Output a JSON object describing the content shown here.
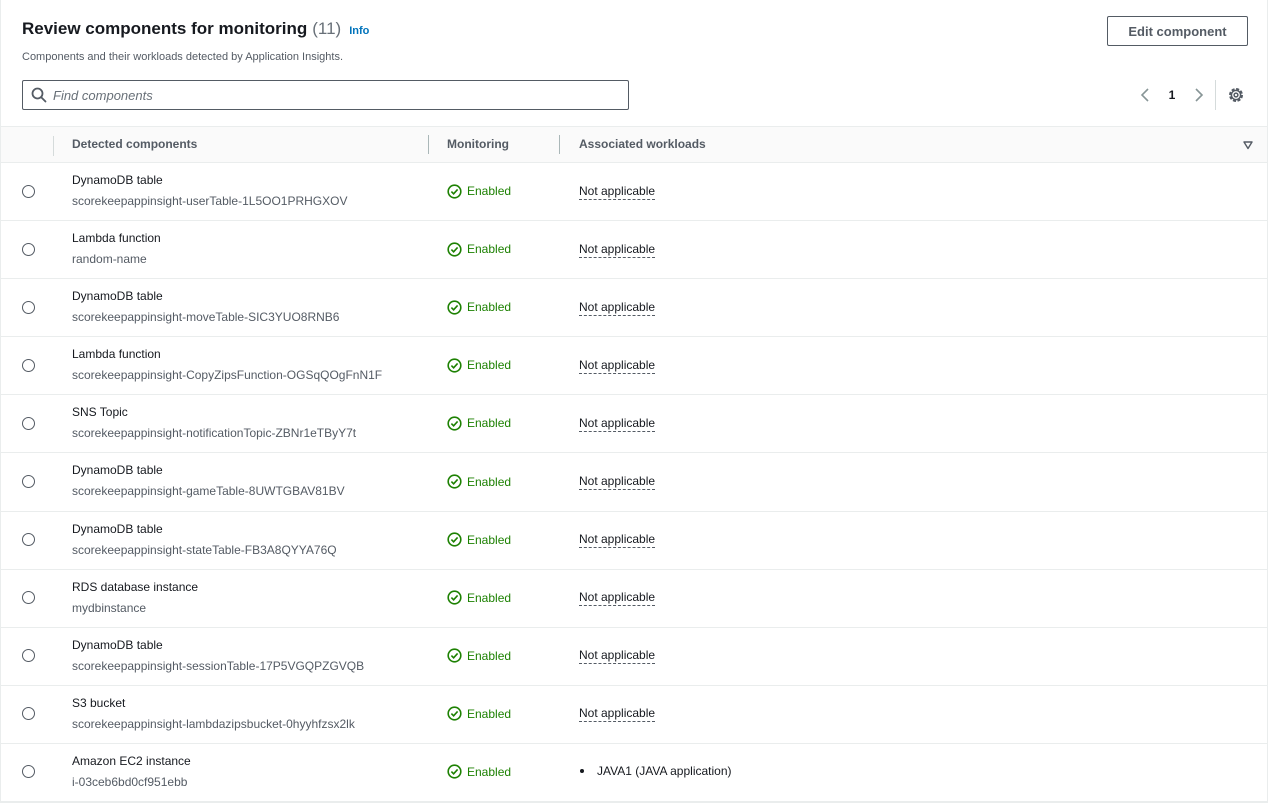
{
  "header": {
    "title": "Review components for monitoring",
    "count": "(11)",
    "info_link": "Info",
    "subtitle": "Components and their workloads detected by Application Insights.",
    "edit_button": "Edit component"
  },
  "search": {
    "placeholder": "Find components",
    "value": ""
  },
  "pagination": {
    "current_page": "1"
  },
  "table": {
    "columns": [
      "Detected components",
      "Monitoring",
      "Associated workloads"
    ],
    "rows": [
      {
        "type": "DynamoDB table",
        "name": "scorekeepappinsight-userTable-1L5OO1PRHGXOV",
        "monitoring": "Enabled",
        "workload": "Not applicable"
      },
      {
        "type": "Lambda function",
        "name": "random-name",
        "monitoring": "Enabled",
        "workload": "Not applicable"
      },
      {
        "type": "DynamoDB table",
        "name": "scorekeepappinsight-moveTable-SIC3YUO8RNB6",
        "monitoring": "Enabled",
        "workload": "Not applicable"
      },
      {
        "type": "Lambda function",
        "name": "scorekeepappinsight-CopyZipsFunction-OGSqQOgFnN1F",
        "monitoring": "Enabled",
        "workload": "Not applicable"
      },
      {
        "type": "SNS Topic",
        "name": "scorekeepappinsight-notificationTopic-ZBNr1eTByY7t",
        "monitoring": "Enabled",
        "workload": "Not applicable"
      },
      {
        "type": "DynamoDB table",
        "name": "scorekeepappinsight-gameTable-8UWTGBAV81BV",
        "monitoring": "Enabled",
        "workload": "Not applicable"
      },
      {
        "type": "DynamoDB table",
        "name": "scorekeepappinsight-stateTable-FB3A8QYYA76Q",
        "monitoring": "Enabled",
        "workload": "Not applicable"
      },
      {
        "type": "RDS database instance",
        "name": "mydbinstance",
        "monitoring": "Enabled",
        "workload": "Not applicable"
      },
      {
        "type": "DynamoDB table",
        "name": "scorekeepappinsight-sessionTable-17P5VGQPZGVQB",
        "monitoring": "Enabled",
        "workload": "Not applicable"
      },
      {
        "type": "S3 bucket",
        "name": "scorekeepappinsight-lambdazipsbucket-0hyyhfzsx2lk",
        "monitoring": "Enabled",
        "workload": "Not applicable"
      },
      {
        "type": "Amazon EC2 instance",
        "name": "i-03ceb6bd0cf951ebb",
        "monitoring": "Enabled",
        "workload_list": [
          "JAVA1 (JAVA application)"
        ]
      }
    ]
  },
  "colors": {
    "link": "#0073bb",
    "success": "#1d8102",
    "text": "#16191f",
    "secondary": "#545b64"
  },
  "icons": {
    "search": "search-icon",
    "status": "check-circle-icon",
    "settings": "gear-icon",
    "prev": "chevron-left-icon",
    "next": "chevron-right-icon",
    "sort": "caret-down-icon"
  }
}
